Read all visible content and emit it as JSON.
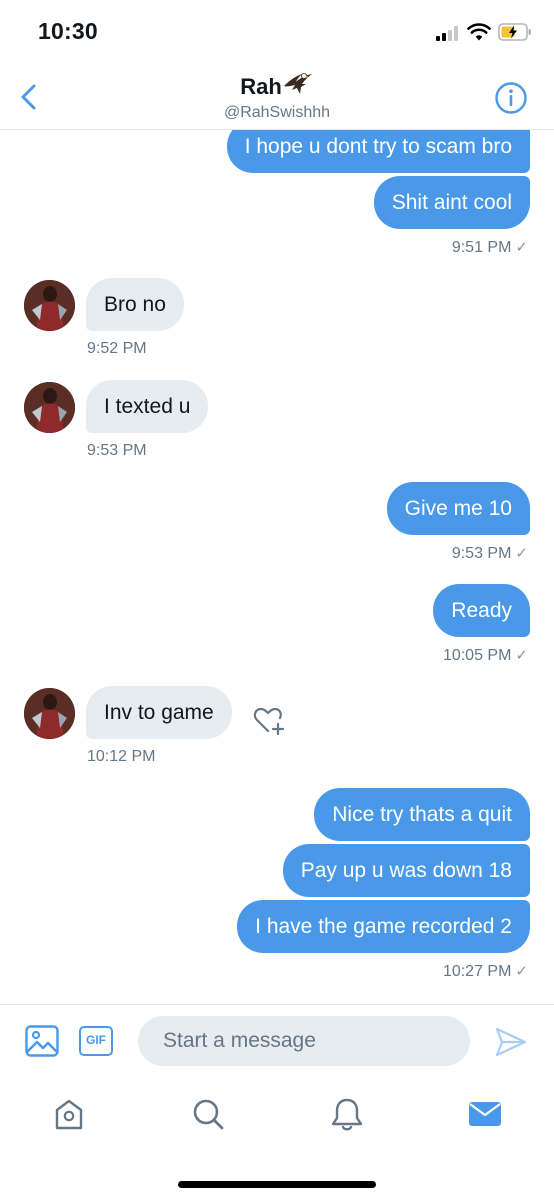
{
  "status_bar": {
    "time": "10:30"
  },
  "header": {
    "name": "Rah",
    "handle": "@RahSwishhh",
    "icons": {
      "back": "chevron-left-icon",
      "info": "info-icon",
      "name_emoji": "eagle-icon"
    }
  },
  "messages": [
    {
      "direction": "out",
      "text": "I hope u dont try to scam bro"
    },
    {
      "direction": "out",
      "text": "Shit aint cool"
    },
    {
      "direction": "out",
      "time": "9:51 PM",
      "read_mark": "✓"
    },
    {
      "direction": "in",
      "text": "Bro no",
      "time": "9:52 PM"
    },
    {
      "direction": "in",
      "text": "I texted u",
      "time": "9:53 PM"
    },
    {
      "direction": "out",
      "text": "Give me 10",
      "time": "9:53 PM",
      "read_mark": "✓"
    },
    {
      "direction": "out",
      "text": "Ready",
      "time": "10:05 PM",
      "read_mark": "✓"
    },
    {
      "direction": "in",
      "text": "Inv to game",
      "time": "10:12 PM"
    },
    {
      "direction": "out",
      "text": "Nice try thats a quit"
    },
    {
      "direction": "out",
      "text": "Pay up u was down 18"
    },
    {
      "direction": "out",
      "text": "I have the game recorded 2",
      "time": "10:27 PM",
      "read_mark": "✓"
    }
  ],
  "composer": {
    "placeholder": "Start a message",
    "gif_label": "GIF",
    "icons": {
      "media": "image-icon",
      "send": "send-icon"
    }
  },
  "tabs": [
    {
      "name": "home",
      "icon": "home-icon"
    },
    {
      "name": "search",
      "icon": "search-icon"
    },
    {
      "name": "notifications",
      "icon": "bell-icon"
    },
    {
      "name": "messages",
      "icon": "mail-icon",
      "active": true
    }
  ],
  "colors": {
    "accent": "#4a99e9",
    "incoming_bubble": "#e6ecf0",
    "secondary_text": "#657786",
    "divider": "#e1e8ed"
  }
}
